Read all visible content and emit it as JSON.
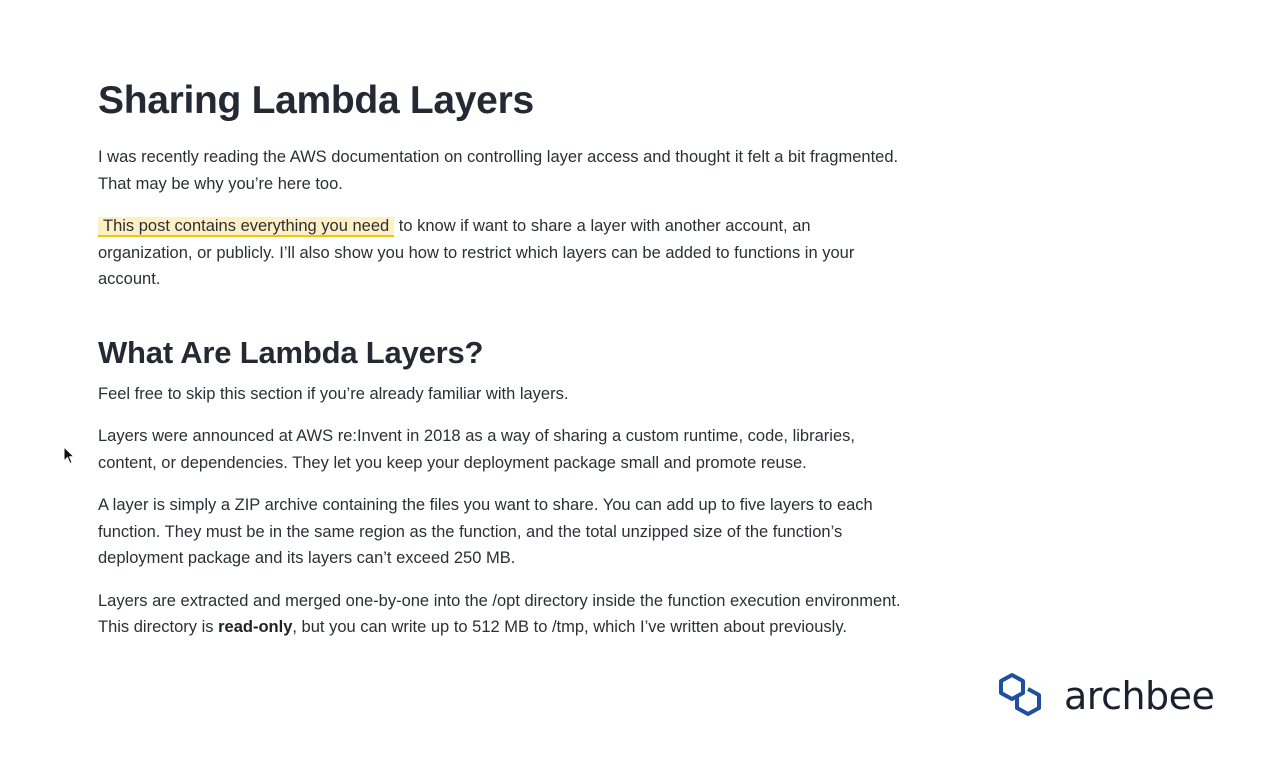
{
  "article": {
    "title": "Sharing Lambda Layers",
    "intro": {
      "p1": "I was recently reading the AWS documentation on controlling layer access and thought it felt a bit fragmented. That may be why you’re here too.",
      "p2_highlight": "This post contains everything you need",
      "p2_rest": " to know if want to share a layer with another account, an organization, or publicly. I’ll also show you how to restrict which layers can be added to functions in your account."
    },
    "section": {
      "heading": "What Are Lambda Layers?",
      "p1": "Feel free to skip this section if you’re already familiar with layers.",
      "p2": "Layers were announced at AWS re:Invent in 2018 as a way of sharing a custom runtime, code, libraries, content, or dependencies. They let you keep your deployment package small and promote reuse.",
      "p3": "A layer is simply a ZIP archive containing the files you want to share. You can add up to five layers to each function. They must be in the same region as the function, and the total unzipped size of the function’s deployment package and its layers can’t exceed 250 MB.",
      "p4_before": "Layers are extracted and merged one-by-one into the /opt directory inside the function execution environment. This directory is ",
      "p4_bold": "read-only",
      "p4_after": ", but you can write up to 512 MB to /tmp, which I’ve written about previously."
    }
  },
  "logo": {
    "text": "archbee",
    "icon": "archbee-hexagon-logo",
    "color": "#1f4fa3"
  },
  "cursor": {
    "icon": "mouse-pointer-icon"
  },
  "colors": {
    "text": "#2b2f36",
    "highlight_bg": "#fdf1c4",
    "highlight_underline": "#f2c21b"
  }
}
